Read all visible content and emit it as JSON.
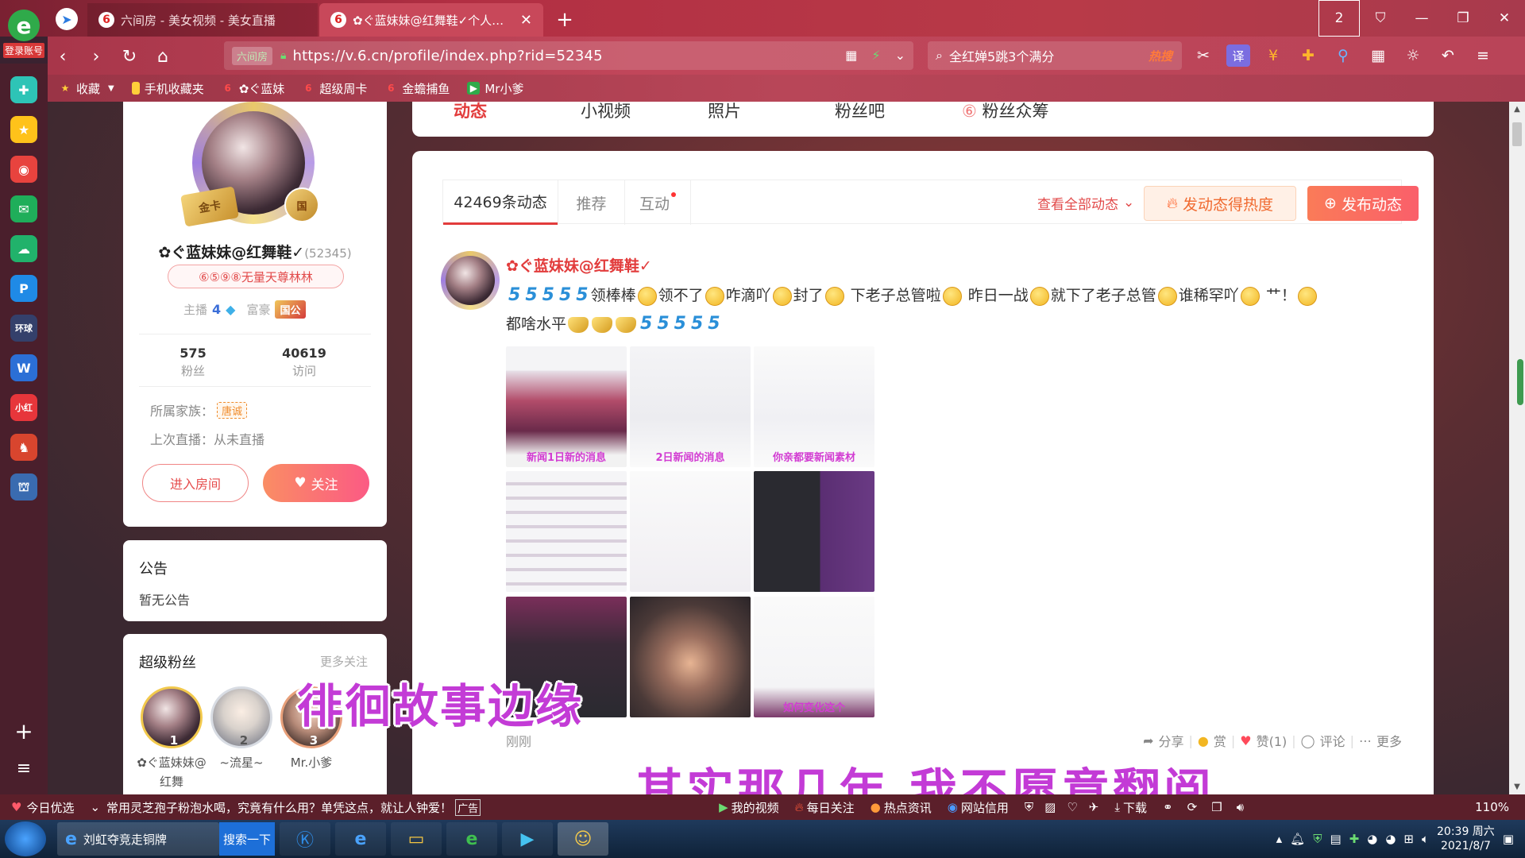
{
  "browser": {
    "login_label": "登录账号",
    "tabs": [
      {
        "title": "六间房 - 美女视频 - 美女直播"
      },
      {
        "title": "✿ぐ蓝妹妹@红舞鞋✓个人动态"
      }
    ],
    "tab_count": "2",
    "url_badge": "六间房",
    "url": "https://v.6.cn/profile/index.php?rid=52345",
    "search_text": "全红婵5跳3个满分",
    "search_hot": "热搜",
    "bookmarks": [
      "收藏",
      "手机收藏夹",
      "✿ぐ蓝妹",
      "超级周卡",
      "金蟾捕鱼",
      "Mr小爹"
    ]
  },
  "profile": {
    "card_label": "金卡",
    "nation_badge": "国",
    "nickname": "✿ぐ蓝妹妹@红舞鞋✓",
    "rid": "(52345)",
    "title_badge": "⑥⑤⑨⑧无量天尊林林",
    "anchor_label": "主播",
    "anchor_level": "4",
    "rich_label": "富豪",
    "rich_badge": "国公",
    "fans_count": "575",
    "fans_label": "粉丝",
    "visits_count": "40619",
    "visits_label": "访问",
    "family_label": "所属家族：",
    "family_tag": "唐诚",
    "last_live": "上次直播：从未直播",
    "enter_room": "进入房间",
    "follow": "关注"
  },
  "notice": {
    "title": "公告",
    "body": "暂无公告"
  },
  "super_fans": {
    "title": "超级粉丝",
    "more": "更多关注",
    "fans": [
      {
        "rank": "1",
        "name": "✿ぐ蓝妹妹@红舞"
      },
      {
        "rank": "2",
        "name": "~流星~"
      },
      {
        "rank": "3",
        "name": "Mr.小爹"
      }
    ]
  },
  "topnav": {
    "items": [
      "动态",
      "小视频",
      "照片",
      "粉丝吧",
      "粉丝众筹"
    ]
  },
  "feed": {
    "tabs": [
      "42469条动态",
      "推荐",
      "互动"
    ],
    "view_all": "查看全部动态",
    "hot_button": "发动态得热度",
    "post_button": "发布动态",
    "post": {
      "author": "✿ぐ蓝妹妹@红舞鞋✓",
      "words": [
        "领棒棒",
        "领不了",
        "咋滴吖",
        "封了",
        "下老子总管啦",
        "昨日一战",
        "就下了老子总管",
        "谁稀罕吖",
        "艹！",
        "都啥水平"
      ],
      "captions": [
        "新闻1日新的消息",
        "2日新闻的消息",
        "你亲都要新闻素材",
        "",
        "",
        "",
        "",
        "",
        "如何变化这个"
      ],
      "time": "刚刚",
      "actions": [
        "分享",
        "赏",
        "赞(1)",
        "评论",
        "更多"
      ]
    }
  },
  "subtitles": {
    "line1": "徘徊故事边缘",
    "line2": "其实那几年 我不愿意翻阅"
  },
  "status_bar": {
    "today": "今日优选",
    "news": "常用灵芝孢子粉泡水喝，究竟有什么用？单凭这点，就让人钟爱！",
    "ad": "广告",
    "my_video": "我的视频",
    "daily": "每日关注",
    "hot_news": "热点资讯",
    "web_report": "网站信用",
    "download": "下载",
    "zoom": "110%"
  },
  "taskbar": {
    "ie_title": "刘虹夺竞走铜牌",
    "search_btn": "搜索一下",
    "time": "20:39 周六",
    "date": "2021/8/7"
  }
}
